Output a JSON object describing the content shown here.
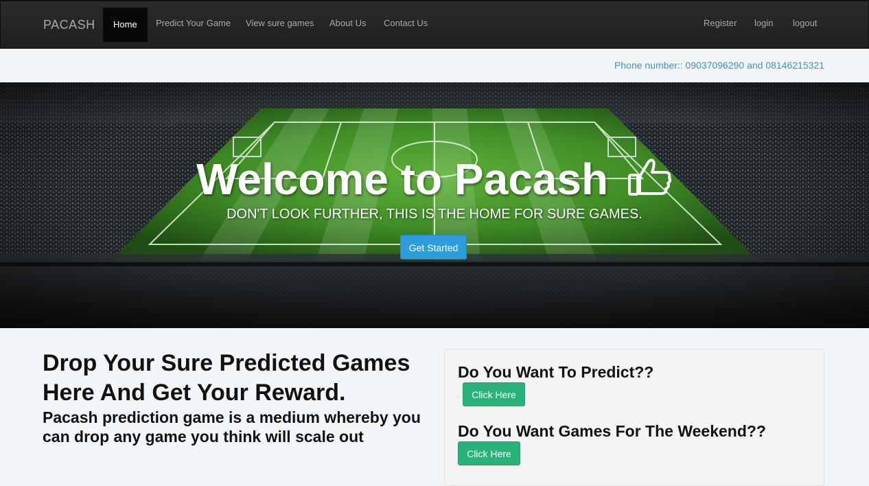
{
  "navbar": {
    "brand": "PACASH",
    "items": [
      {
        "label": "Home",
        "active": true
      },
      {
        "label": "Predict Your Game"
      },
      {
        "label": "View sure games"
      },
      {
        "label": "About Us"
      },
      {
        "label": "Contact Us"
      }
    ],
    "right_items": [
      {
        "label": "Register"
      },
      {
        "label": "login"
      },
      {
        "label": "logout"
      }
    ]
  },
  "contact": {
    "phone": "Phone number:: 09037096290 and 08146215321"
  },
  "hero": {
    "title": "Welcome to Pacash",
    "title_icon": "thumbs-up-icon",
    "subtitle": "DON'T LOOK FURTHER, THIS IS THE HOME FOR SURE GAMES.",
    "cta_label": "Get Started",
    "background": "football-stadium-image"
  },
  "intro": {
    "heading": "Drop Your Sure Predicted Games Here And Get Your Reward.",
    "body": "Pacash prediction game is a medium whereby you can drop any game you think will scale out"
  },
  "panel": {
    "predict_heading": "Do You Want To Predict??",
    "predict_button": "Click Here",
    "weekend_heading": "Do You Want Games For The Weekend??",
    "weekend_button": "Click Here"
  },
  "colors": {
    "navbar_bg": "#222222",
    "link_blue": "#3b93c9",
    "primary_button": "#2f9cdc",
    "success_button": "#2ab27b"
  }
}
